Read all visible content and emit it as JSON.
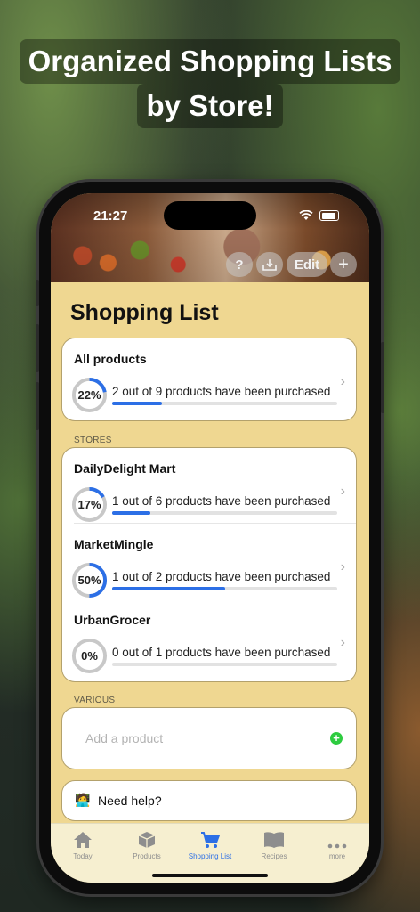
{
  "headline": {
    "line1": "Organized Shopping Lists",
    "line2": "by Store!"
  },
  "status": {
    "time": "21:27"
  },
  "header_buttons": {
    "help": "?",
    "edit": "Edit",
    "add": "+"
  },
  "title": "Shopping List",
  "all_products": {
    "name": "All products",
    "percent": "22%",
    "progress_text": "2 out of 9 products have been purchased",
    "fraction": 0.22
  },
  "sections": {
    "stores": "STORES",
    "various": "VARIOUS"
  },
  "stores": [
    {
      "name": "DailyDelight Mart",
      "percent": "17%",
      "progress_text": "1 out of 6 products have been purchased",
      "fraction": 0.17
    },
    {
      "name": "MarketMingle",
      "percent": "50%",
      "progress_text": "1 out of 2 products have been purchased",
      "fraction": 0.5
    },
    {
      "name": "UrbanGrocer",
      "percent": "0%",
      "progress_text": "0 out of 1 products have been purchased",
      "fraction": 0.0
    }
  ],
  "various": {
    "add_placeholder": "Add a product"
  },
  "help": {
    "label": "Need help?",
    "icon": "person-at-laptop-icon"
  },
  "tabs": [
    {
      "label": "Today",
      "icon": "house-icon",
      "active": false
    },
    {
      "label": "Products",
      "icon": "cube-icon",
      "active": false
    },
    {
      "label": "Shopping List",
      "icon": "cart-icon",
      "active": true
    },
    {
      "label": "Recipes",
      "icon": "book-icon",
      "active": false
    },
    {
      "label": "more",
      "icon": "ellipsis-icon",
      "active": false
    }
  ],
  "colors": {
    "accent": "#2c6fe6",
    "background": "#efd791",
    "add": "#2ecc40"
  }
}
